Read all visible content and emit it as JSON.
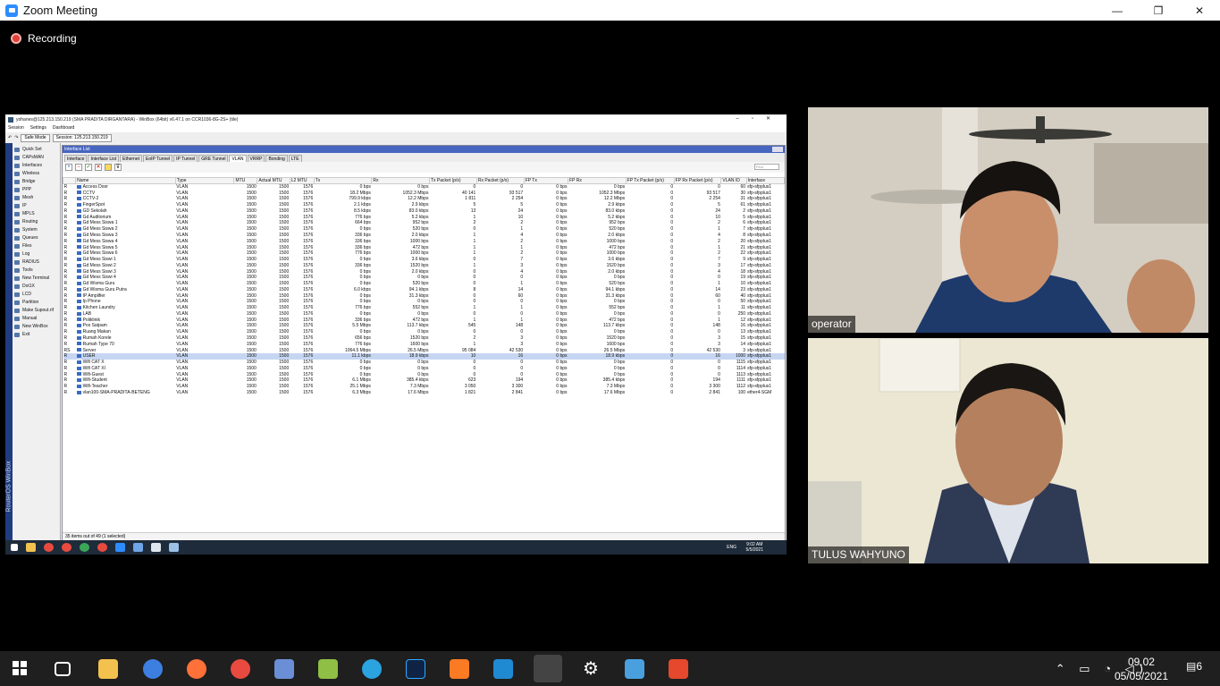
{
  "window": {
    "title": "Zoom Meeting",
    "minimize": "—",
    "maximize": "❐",
    "close": "✕"
  },
  "recording": {
    "label": "Recording"
  },
  "winbox": {
    "title": "yohanes@125.213.150.219 (SMA PRADITA DIRGANTARA) - WinBox (64bit) v6.47.1 on CCR1036-8G-2S+ (tile)",
    "menu": [
      "Session",
      "Settings",
      "Dashboard"
    ],
    "safe_mode": "Safe Mode",
    "session": "Session: 125.213.150.219",
    "sidebar_vertical": "RouterOS WinBox",
    "sidebar": [
      "Quick Set",
      "CAPsMAN",
      "Interfaces",
      "Wireless",
      "Bridge",
      "PPP",
      "Mesh",
      "IP",
      "MPLS",
      "Routing",
      "System",
      "Queues",
      "Files",
      "Log",
      "RADIUS",
      "Tools",
      "New Terminal",
      "Dot1X",
      "LCD",
      "Partition",
      "Make Supout.rif",
      "Manual",
      "New WinBox",
      "Exit"
    ],
    "panel_title": "Interface List",
    "tabs": [
      "Interface",
      "Interface List",
      "Ethernet",
      "EoIP Tunnel",
      "IP Tunnel",
      "GRE Tunnel",
      "VLAN",
      "VRRP",
      "Bonding",
      "LTE"
    ],
    "active_tab": "VLAN",
    "find_placeholder": "Find",
    "columns": [
      "",
      "Name",
      "Type",
      "MTU",
      "Actual MTU",
      "L2 MTU",
      "Tx",
      "Rx",
      "Tx Packet (p/s)",
      "Rx Packet (p/s)",
      "FP Tx",
      "FP Rx",
      "FP Tx Packet (p/s)",
      "FP Rx Packet (p/s)",
      "VLAN ID",
      "Interface"
    ],
    "rows": [
      [
        "R",
        "Access Door",
        "VLAN",
        "1500",
        "1500",
        "1576",
        "0 bps",
        "0 bps",
        "0",
        "0",
        "0 bps",
        "0 bps",
        "0",
        "0",
        "60",
        "sfp-sfpplus1"
      ],
      [
        "R",
        "CCTV",
        "VLAN",
        "1500",
        "1500",
        "1576",
        "18.2 Mbps",
        "1052.3 Mbps",
        "40 141",
        "93 517",
        "0 bps",
        "1052.3 Mbps",
        "0",
        "93 517",
        "30",
        "sfp-sfpplus1"
      ],
      [
        "R",
        "CCTV-2",
        "VLAN",
        "1500",
        "1500",
        "1576",
        "799.9 kbps",
        "12.2 Mbps",
        "1 811",
        "2 254",
        "0 bps",
        "12.2 Mbps",
        "0",
        "2 254",
        "31",
        "sfp-sfpplus1"
      ],
      [
        "R",
        "FingerSpot",
        "VLAN",
        "1500",
        "1500",
        "1576",
        "2.1 kbps",
        "2.9 kbps",
        "5",
        "5",
        "0 bps",
        "2.9 kbps",
        "0",
        "5",
        "61",
        "sfp-sfpplus1"
      ],
      [
        "R",
        "GD Sekolah",
        "VLAN",
        "1500",
        "1500",
        "1576",
        "8.5 kbps",
        "83.0 kbps",
        "13",
        "24",
        "0 bps",
        "83.0 kbps",
        "0",
        "24",
        "2",
        "sfp-sfpplus1"
      ],
      [
        "R",
        "Gd Auditorium",
        "VLAN",
        "1500",
        "1500",
        "1576",
        "776 bps",
        "5.2 kbps",
        "1",
        "10",
        "0 bps",
        "5.2 kbps",
        "0",
        "10",
        "5",
        "sfp-sfpplus1"
      ],
      [
        "R",
        "Gd Mess Siswa 1",
        "VLAN",
        "1500",
        "1500",
        "1576",
        "664 bps",
        "952 bps",
        "2",
        "2",
        "0 bps",
        "952 bps",
        "0",
        "2",
        "6",
        "sfp-sfpplus1"
      ],
      [
        "R",
        "Gd Mess Siswa 2",
        "VLAN",
        "1500",
        "1500",
        "1576",
        "0 bps",
        "520 bps",
        "0",
        "1",
        "0 bps",
        "520 bps",
        "0",
        "1",
        "7",
        "sfp-sfpplus1"
      ],
      [
        "R",
        "Gd Mess Siswa 3",
        "VLAN",
        "1500",
        "1500",
        "1576",
        "336 bps",
        "2.0 kbps",
        "1",
        "4",
        "0 bps",
        "2.0 kbps",
        "0",
        "4",
        "8",
        "sfp-sfpplus1"
      ],
      [
        "R",
        "Gd Mess Siswa 4",
        "VLAN",
        "1500",
        "1500",
        "1576",
        "336 bps",
        "1000 bps",
        "1",
        "2",
        "0 bps",
        "1000 bps",
        "0",
        "2",
        "20",
        "sfp-sfpplus1"
      ],
      [
        "R",
        "Gd Mess Siswa 5",
        "VLAN",
        "1500",
        "1500",
        "1576",
        "336 bps",
        "472 bps",
        "1",
        "1",
        "0 bps",
        "472 bps",
        "0",
        "1",
        "21",
        "sfp-sfpplus1"
      ],
      [
        "R",
        "Gd Mess Siswa 6",
        "VLAN",
        "1500",
        "1500",
        "1576",
        "776 bps",
        "1000 bps",
        "1",
        "2",
        "0 bps",
        "1000 bps",
        "0",
        "2",
        "22",
        "sfp-sfpplus1"
      ],
      [
        "R",
        "Gd Mess Siswi 1",
        "VLAN",
        "1500",
        "1500",
        "1576",
        "0 bps",
        "3.6 kbps",
        "0",
        "7",
        "0 bps",
        "3.6 kbps",
        "0",
        "7",
        "9",
        "sfp-sfpplus1"
      ],
      [
        "R",
        "Gd Mess Siswi 2",
        "VLAN",
        "1500",
        "1500",
        "1576",
        "336 bps",
        "1520 bps",
        "1",
        "3",
        "0 bps",
        "1520 bps",
        "0",
        "3",
        "17",
        "sfp-sfpplus1"
      ],
      [
        "R",
        "Gd Mess Siswi 3",
        "VLAN",
        "1500",
        "1500",
        "1576",
        "0 bps",
        "2.0 kbps",
        "0",
        "4",
        "0 bps",
        "2.0 kbps",
        "0",
        "4",
        "18",
        "sfp-sfpplus1"
      ],
      [
        "R",
        "Gd Mess Siswi 4",
        "VLAN",
        "1500",
        "1500",
        "1576",
        "0 bps",
        "0 bps",
        "0",
        "0",
        "0 bps",
        "0 bps",
        "0",
        "0",
        "19",
        "sfp-sfpplus1"
      ],
      [
        "R",
        "Gd Wisma Guru",
        "VLAN",
        "1500",
        "1500",
        "1576",
        "0 bps",
        "520 bps",
        "0",
        "1",
        "0 bps",
        "520 bps",
        "0",
        "1",
        "10",
        "sfp-sfpplus1"
      ],
      [
        "R",
        "Gd Wisma Guru Putra",
        "VLAN",
        "1500",
        "1500",
        "1576",
        "6.0 kbps",
        "94.1 kbps",
        "8",
        "14",
        "0 bps",
        "94.1 kbps",
        "0",
        "14",
        "23",
        "sfp-sfpplus1"
      ],
      [
        "R",
        "IP Amplifier",
        "VLAN",
        "1500",
        "1500",
        "1576",
        "0 bps",
        "31.3 kbps",
        "0",
        "60",
        "0 bps",
        "31.3 kbps",
        "0",
        "60",
        "40",
        "sfp-sfpplus1"
      ],
      [
        "R",
        "Ip Phone",
        "VLAN",
        "1500",
        "1500",
        "1576",
        "0 bps",
        "0 bps",
        "0",
        "0",
        "0 bps",
        "0 bps",
        "0",
        "0",
        "50",
        "sfp-sfpplus1"
      ],
      [
        "R",
        "Kitchen Laundry",
        "VLAN",
        "1500",
        "1500",
        "1576",
        "776 bps",
        "552 bps",
        "1",
        "1",
        "0 bps",
        "552 bps",
        "0",
        "1",
        "11",
        "sfp-sfpplus1"
      ],
      [
        "R",
        "LAB",
        "VLAN",
        "1500",
        "1500",
        "1576",
        "0 bps",
        "0 bps",
        "0",
        "0",
        "0 bps",
        "0 bps",
        "0",
        "0",
        "250",
        "sfp-sfpplus1"
      ],
      [
        "R",
        "Poliklinik",
        "VLAN",
        "1500",
        "1500",
        "1576",
        "336 bps",
        "472 bps",
        "1",
        "1",
        "0 bps",
        "472 bps",
        "0",
        "1",
        "12",
        "sfp-sfpplus1"
      ],
      [
        "R",
        "Pos Satpam",
        "VLAN",
        "1500",
        "1500",
        "1576",
        "5.5 Mbps",
        "113.7 kbps",
        "545",
        "148",
        "0 bps",
        "113.7 kbps",
        "0",
        "148",
        "16",
        "sfp-sfpplus1"
      ],
      [
        "R",
        "Ruang Makan",
        "VLAN",
        "1500",
        "1500",
        "1576",
        "0 bps",
        "0 bps",
        "0",
        "0",
        "0 bps",
        "0 bps",
        "0",
        "0",
        "13",
        "sfp-sfpplus1"
      ],
      [
        "R",
        "Rumah Korele",
        "VLAN",
        "1500",
        "1500",
        "1576",
        "656 bps",
        "1520 bps",
        "2",
        "3",
        "0 bps",
        "1520 bps",
        "0",
        "3",
        "15",
        "sfp-sfpplus1"
      ],
      [
        "R",
        "Rumah Type 70",
        "VLAN",
        "1500",
        "1500",
        "1576",
        "776 bps",
        "1600 bps",
        "1",
        "3",
        "0 bps",
        "1600 bps",
        "0",
        "3",
        "14",
        "sfp-sfpplus1"
      ],
      [
        "RS",
        "Server",
        "VLAN",
        "1500",
        "1500",
        "1576",
        "1064.5 Mbps",
        "26.5 Mbps",
        "95 084",
        "42 530",
        "0 bps",
        "26.5 Mbps",
        "0",
        "42 530",
        "3",
        "sfp-sfpplus1"
      ],
      [
        "R",
        "USER",
        "VLAN",
        "1500",
        "1500",
        "1576",
        "11.1 kbps",
        "18.9 kbps",
        "10",
        "16",
        "0 bps",
        "18.9 kbps",
        "0",
        "16",
        "1000",
        "sfp-sfpplus1"
      ],
      [
        "R",
        "Wifi CAT X",
        "VLAN",
        "1500",
        "1500",
        "1576",
        "0 bps",
        "0 bps",
        "0",
        "0",
        "0 bps",
        "0 bps",
        "0",
        "0",
        "1115",
        "sfp-sfpplus1"
      ],
      [
        "R",
        "Wifi CAT XI",
        "VLAN",
        "1500",
        "1500",
        "1576",
        "0 bps",
        "0 bps",
        "0",
        "0",
        "0 bps",
        "0 bps",
        "0",
        "0",
        "1114",
        "sfp-sfpplus1"
      ],
      [
        "R",
        "Wifi-Guest",
        "VLAN",
        "1500",
        "1500",
        "1576",
        "0 bps",
        "0 bps",
        "0",
        "0",
        "0 bps",
        "0 bps",
        "0",
        "0",
        "1113",
        "sfp-sfpplus1"
      ],
      [
        "R",
        "Wifi-Student",
        "VLAN",
        "1500",
        "1500",
        "1576",
        "6.1 Mbps",
        "385.4 kbps",
        "623",
        "194",
        "0 bps",
        "385.4 kbps",
        "0",
        "194",
        "1111",
        "sfp-sfpplus1"
      ],
      [
        "R",
        "Wifi-Teacher",
        "VLAN",
        "1500",
        "1500",
        "1576",
        "25.1 Mbps",
        "7.3 Mbps",
        "3 050",
        "3 300",
        "0 bps",
        "7.3 Mbps",
        "0",
        "3 300",
        "1112",
        "sfp-sfpplus1"
      ],
      [
        "R",
        "vlan100-SMA-PRADITA-BETENG",
        "VLAN",
        "1500",
        "1500",
        "1576",
        "6.3 Mbps",
        "17.6 Mbps",
        "1 821",
        "2 841",
        "0 bps",
        "17.6 Mbps",
        "0",
        "2 841",
        "100",
        "ether4-SGM"
      ]
    ],
    "selected_row": 28,
    "status": "35 items out of 49 (1 selected)",
    "inner_clock_time": "9:02 AM",
    "inner_clock_date": "5/5/2021",
    "inner_tray": "ENG"
  },
  "participants": [
    {
      "name": "operator"
    },
    {
      "name": "TULUS WAHYUNO"
    }
  ],
  "taskbar": {
    "icons": [
      "explorer-task-view",
      "file-explorer",
      "edge",
      "firefox",
      "chrome",
      "network-app",
      "vmware",
      "telegram",
      "photoshop",
      "xampp",
      "vscode",
      "zoom",
      "settings",
      "control-panel",
      "foxit"
    ],
    "time": "09.02",
    "date": "05/05/2021",
    "notifications": "6"
  }
}
